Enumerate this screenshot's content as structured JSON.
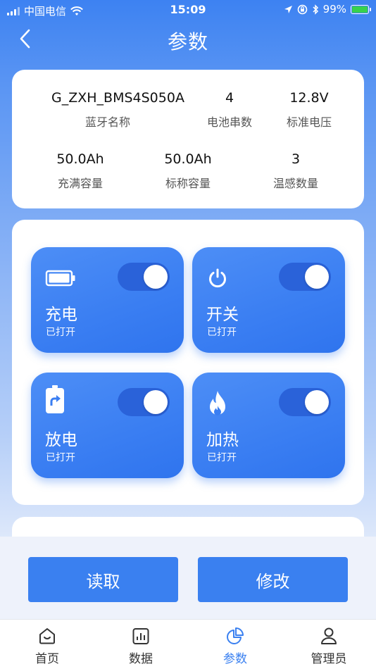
{
  "status_bar": {
    "carrier": "中国电信",
    "time": "15:09",
    "battery_percent": "99%"
  },
  "nav": {
    "title": "参数"
  },
  "info": {
    "bluetooth_name": {
      "value": "G_ZXH_BMS4S050A",
      "label": "蓝牙名称"
    },
    "cell_count": {
      "value": "4",
      "label": "电池串数"
    },
    "nominal_voltage": {
      "value": "12.8V",
      "label": "标准电压"
    },
    "full_capacity": {
      "value": "50.0Ah",
      "label": "充满容量"
    },
    "nominal_capacity": {
      "value": "50.0Ah",
      "label": "标称容量"
    },
    "temp_sensor_count": {
      "value": "3",
      "label": "温感数量"
    }
  },
  "switches": [
    {
      "title": "充电",
      "status": "已打开",
      "icon": "battery-icon",
      "on": true
    },
    {
      "title": "开关",
      "status": "已打开",
      "icon": "power-icon",
      "on": true
    },
    {
      "title": "放电",
      "status": "已打开",
      "icon": "discharge-icon",
      "on": true
    },
    {
      "title": "加热",
      "status": "已打开",
      "icon": "flame-icon",
      "on": true
    }
  ],
  "actions": {
    "read_label": "读取",
    "modify_label": "修改"
  },
  "tabs": [
    {
      "label": "首页",
      "icon": "home-icon",
      "active": false
    },
    {
      "label": "数据",
      "icon": "chart-icon",
      "active": false
    },
    {
      "label": "参数",
      "icon": "pie-icon",
      "active": true
    },
    {
      "label": "管理员",
      "icon": "user-icon",
      "active": false
    }
  ],
  "colors": {
    "primary": "#3a80f0",
    "toggle_track": "#2a62d9",
    "battery_green": "#38d14d"
  }
}
